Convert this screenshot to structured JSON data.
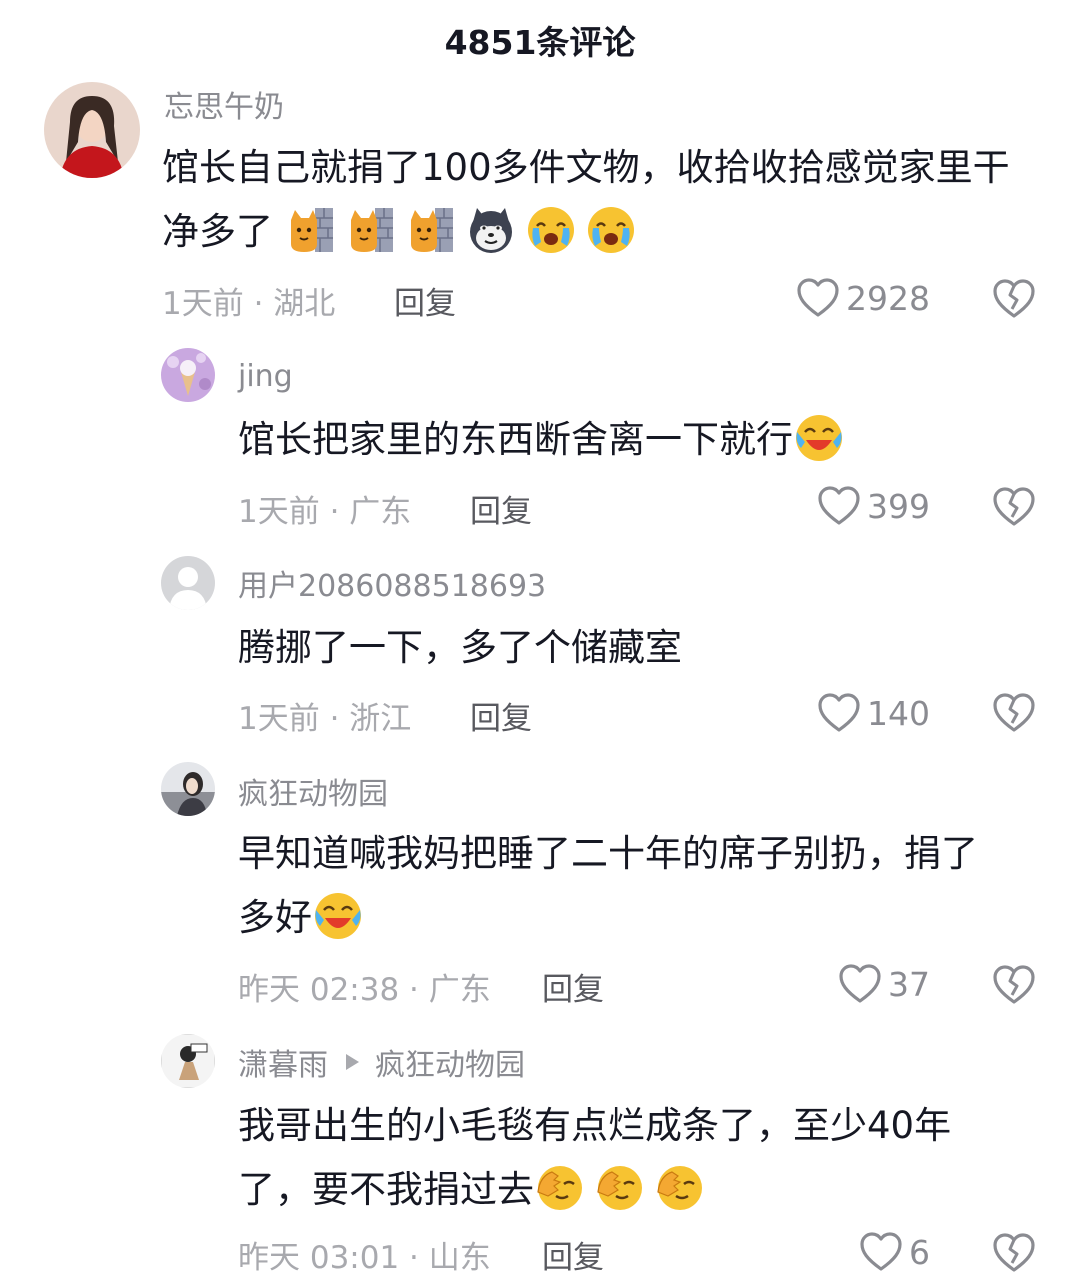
{
  "header": {
    "title": "4851条评论"
  },
  "comments": [
    {
      "username": "忘思午奶",
      "text": "馆长自己就捐了100多件文物，收拾收拾感觉家里干净多了",
      "emojis": [
        "cat-wall-emoji",
        "cat-wall-emoji",
        "cat-wall-emoji",
        "husky-emoji",
        "crying-emoji",
        "crying-emoji"
      ],
      "time": "1天前 · 湖北",
      "reply_label": "回复",
      "likes": "2928"
    },
    {
      "username": "jing",
      "text": "馆长把家里的东西断舍离一下就行",
      "emojis": [
        "laugh-cry-emoji"
      ],
      "time": "1天前 · 广东",
      "reply_label": "回复",
      "likes": "399"
    },
    {
      "username": "用户2086088518693",
      "text": "腾挪了一下，多了个储藏室",
      "emojis": [],
      "time": "1天前 · 浙江",
      "reply_label": "回复",
      "likes": "140"
    },
    {
      "username": "疯狂动物园",
      "text_line1": "早知道喊我妈把睡了二十年的席子别扔，捐了",
      "text_line2": "多好",
      "emojis": [
        "laugh-cry-emoji"
      ],
      "time": "昨天 02:38 · 广东",
      "reply_label": "回复",
      "likes": "37"
    },
    {
      "username": "潇暮雨",
      "reply_to": "疯狂动物园",
      "text_line1": "我哥出生的小毛毯有点烂成条了，至少40年",
      "text_line2": "了，要不我捐过去",
      "emojis": [
        "facepalm-emoji",
        "facepalm-emoji",
        "facepalm-emoji"
      ],
      "time": "昨天 03:01 · 山东",
      "reply_label": "回复",
      "likes": "6"
    }
  ],
  "colors": {
    "text": "#161823",
    "muted": "#a8a9ae",
    "username": "#8a8b91",
    "emoji_yellow": "#f7c331"
  }
}
